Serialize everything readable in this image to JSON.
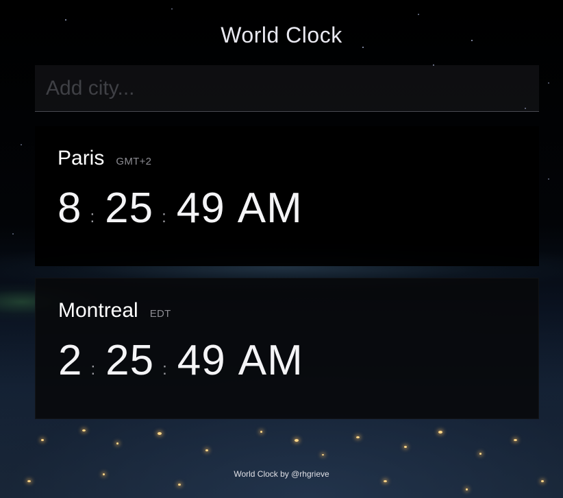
{
  "app": {
    "title": "World Clock"
  },
  "search": {
    "placeholder": "Add city...",
    "value": ""
  },
  "cities": [
    {
      "name": "Paris",
      "timezone": "GMT+2",
      "hours": "8",
      "minutes": "25",
      "seconds": "49",
      "period": "AM",
      "separator": ":"
    },
    {
      "name": "Montreal",
      "timezone": "EDT",
      "hours": "2",
      "minutes": "25",
      "seconds": "49",
      "period": "AM",
      "separator": ":"
    }
  ],
  "footer": {
    "text": "World Clock by @rhgrieve"
  },
  "colors": {
    "background": "#020306",
    "card": "#000000",
    "text": "#ffffff",
    "muted": "#8d8d93"
  }
}
